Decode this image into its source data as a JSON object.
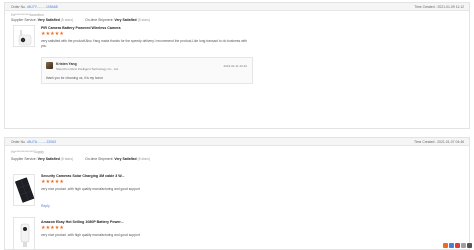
{
  "orders": [
    {
      "order_no_label": "Order No.",
      "order_no": "x5U7Y..........105A68",
      "time_created": "Time Created : 2021-01-09 11:12",
      "buyer": "Hx***********Accretion",
      "supplier_service_label": "Supplier Service:",
      "supplier_service_value": "Very Satisfied",
      "supplier_service_stars": "(5 stars)",
      "shipment_label": "On-time Shipment:",
      "shipment_value": "Very Satisfied",
      "shipment_stars": "(5 stars)",
      "items": [
        {
          "title": "PIR Camera Battery Powered Wireless Camera",
          "stars": "★★★★★",
          "review": "very satisfied with the product!Also Yang maria thanks for the speedy delivery.I recommend the product,Like long transact to do business with you",
          "reply": {
            "seller_name": "Kristen Yang",
            "company": "Shenzhen Ruixi Intelligent Technology Co., Ltd.",
            "time": "2021-01-11 22:22",
            "message": "thank you for choosing us, it is my honor"
          }
        }
      ]
    },
    {
      "order_no_label": "Order No.",
      "order_no": "x5U7A..........22063",
      "time_created": "Time Created : 2021-01-07 04:46",
      "buyer": "Hx**************Supply",
      "supplier_service_label": "Supplier Service:",
      "supplier_service_value": "Very Satisfied",
      "supplier_service_stars": "(5 stars)",
      "shipment_label": "On-time Shipment:",
      "shipment_value": "Very Satisfied",
      "shipment_stars": "(5 stars)",
      "items": [
        {
          "title": "Security Cameras Solar Charging 3M cable 3 W...",
          "stars": "★★★★★",
          "review": "very nice product ,with high quality manufacturing and good support",
          "reply_label": "Reply"
        },
        {
          "title": "Amazon Ebay Hot Selling 1080P Battery Power...",
          "stars": "★★★★★",
          "review": "very nice product ,with high quality manufacturing and good support"
        }
      ]
    }
  ],
  "colors": {
    "star": "#f06a1e",
    "link": "#4a7fd6"
  }
}
